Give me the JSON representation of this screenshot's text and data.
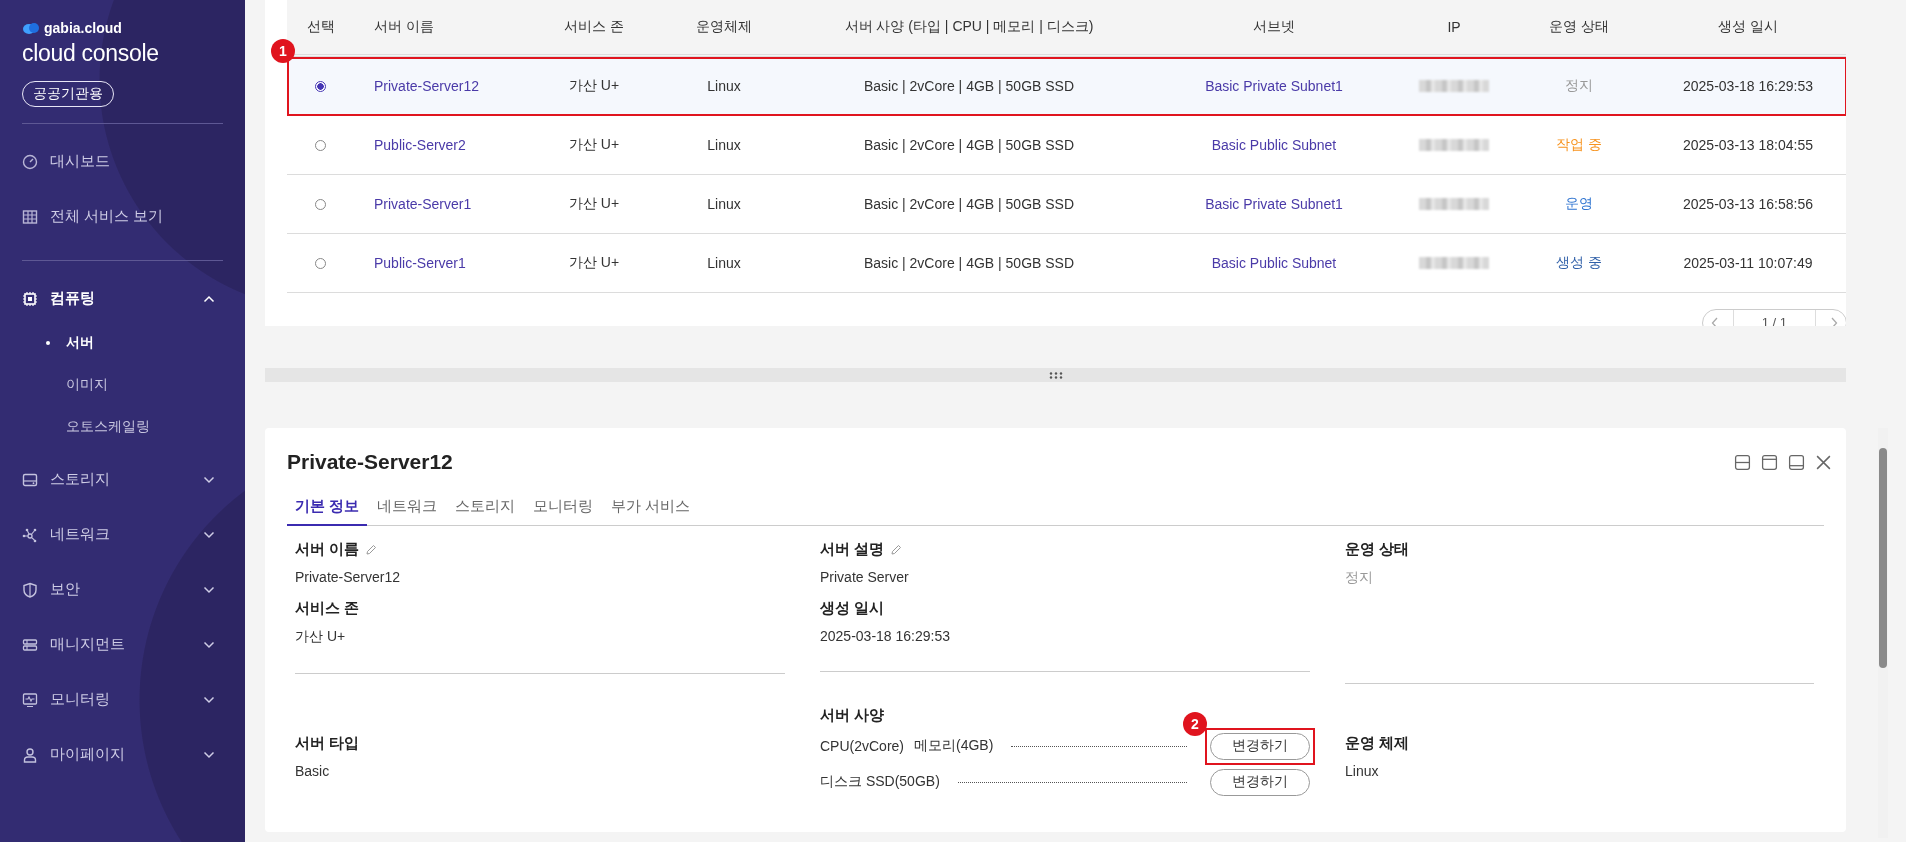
{
  "sidebar": {
    "brand": "gabia.cloud",
    "product": "cloud console",
    "badge": "공공기관용",
    "top_items": [
      {
        "label": "대시보드"
      },
      {
        "label": "전체 서비스 보기"
      }
    ],
    "menu": [
      {
        "label": "컴퓨팅",
        "expanded": true,
        "children": [
          {
            "label": "서버",
            "selected": true
          },
          {
            "label": "이미지",
            "selected": false
          },
          {
            "label": "오토스케일링",
            "selected": false
          }
        ]
      },
      {
        "label": "스토리지",
        "expanded": false
      },
      {
        "label": "네트워크",
        "expanded": false
      },
      {
        "label": "보안",
        "expanded": false
      },
      {
        "label": "매니지먼트",
        "expanded": false
      },
      {
        "label": "모니터링",
        "expanded": false
      },
      {
        "label": "마이페이지",
        "expanded": false
      }
    ]
  },
  "server_table": {
    "columns": [
      "선택",
      "서버 이름",
      "서비스 존",
      "운영체제",
      "서버 사양 (타입 | CPU | 메모리 | 디스크)",
      "서브넷",
      "IP",
      "운영 상태",
      "생성 일시"
    ],
    "rows": [
      {
        "selected": true,
        "callout": "1",
        "name": "Private-Server12",
        "zone": "가산 U+",
        "os": "Linux",
        "spec": "Basic | 2vCore | 4GB | 50GB SSD",
        "subnet": "Basic Private Subnet1",
        "status": {
          "text": "정지",
          "color": "#999999"
        },
        "created": "2025-03-18 16:29:53"
      },
      {
        "selected": false,
        "name": "Public-Server2",
        "zone": "가산 U+",
        "os": "Linux",
        "spec": "Basic | 2vCore | 4GB | 50GB SSD",
        "subnet": "Basic Public Subnet",
        "status": {
          "text": "작업 중",
          "color": "#f7931e"
        },
        "created": "2025-03-13 18:04:55"
      },
      {
        "selected": false,
        "name": "Private-Server1",
        "zone": "가산 U+",
        "os": "Linux",
        "spec": "Basic | 2vCore | 4GB | 50GB SSD",
        "subnet": "Basic Private Subnet1",
        "status": {
          "text": "운영",
          "color": "#2f74d0"
        },
        "created": "2025-03-13 16:58:56"
      },
      {
        "selected": false,
        "name": "Public-Server1",
        "zone": "가산 U+",
        "os": "Linux",
        "spec": "Basic | 2vCore | 4GB | 50GB SSD",
        "subnet": "Basic Public Subnet",
        "status": {
          "text": "생성 중",
          "color": "#2f5fa8"
        },
        "created": "2025-03-11 10:07:49"
      }
    ],
    "pagination": "1 / 1"
  },
  "detail": {
    "title": "Private-Server12",
    "tabs": [
      {
        "label": "기본 정보",
        "selected": true
      },
      {
        "label": "네트워크",
        "selected": false
      },
      {
        "label": "스토리지",
        "selected": false
      },
      {
        "label": "모니터링",
        "selected": false
      },
      {
        "label": "부가 서비스",
        "selected": false
      }
    ],
    "top_columns": [
      [
        {
          "label": "서버 이름",
          "editable": true,
          "value": "Private-Server12"
        },
        {
          "label": "서비스 존",
          "editable": false,
          "value": "가산 U+"
        }
      ],
      [
        {
          "label": "서버 설명",
          "editable": true,
          "value": "Private Server"
        },
        {
          "label": "생성 일시",
          "editable": false,
          "value": "2025-03-18 16:29:53"
        }
      ],
      [
        {
          "label": "운영 상태",
          "editable": false,
          "value": "정지",
          "color": "#999999"
        }
      ]
    ],
    "server_type": {
      "label": "서버 타입",
      "value": "Basic"
    },
    "spec": {
      "label": "서버 사양",
      "items": [
        {
          "parts": [
            "CPU(2vCore)",
            "메모리(4GB)"
          ],
          "button": "변경하기",
          "callout": "2"
        },
        {
          "parts": [
            "디스크 SSD(50GB)"
          ],
          "button": "변경하기"
        }
      ]
    },
    "os": {
      "label": "운영 체제",
      "value": "Linux"
    }
  }
}
